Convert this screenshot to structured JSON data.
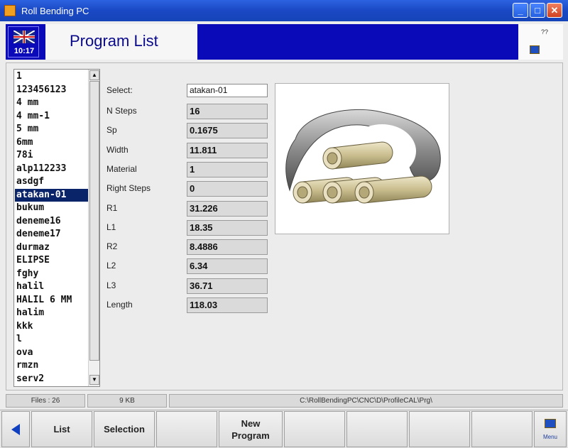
{
  "window": {
    "title": "Roll Bending PC"
  },
  "header": {
    "time": "10:17",
    "page_title": "Program List",
    "right_mark": "??"
  },
  "program_list": {
    "selected_index": 9,
    "items": [
      "1",
      "123456123",
      "4 mm",
      "4 mm-1",
      "5 mm",
      "6mm",
      "78i",
      "alp112233",
      "asdgf",
      "atakan-01",
      "bukum",
      "deneme16",
      "deneme17",
      "durmaz",
      "ELIPSE",
      "fghy",
      "halil",
      "HALIL 6 MM",
      "halim",
      "kkk",
      "l",
      "ova",
      "rmzn",
      "serv2"
    ]
  },
  "fields": {
    "select": {
      "label": "Select:",
      "value": "atakan-01"
    },
    "rows": [
      {
        "label": "N Steps",
        "value": "16"
      },
      {
        "label": "Sp",
        "value": "0.1675"
      },
      {
        "label": "Width",
        "value": "11.811"
      },
      {
        "label": "Material",
        "value": "1"
      },
      {
        "label": "Right Steps",
        "value": "0"
      },
      {
        "label": "R1",
        "value": "31.226"
      },
      {
        "label": "L1",
        "value": "18.35"
      },
      {
        "label": "R2",
        "value": "8.4886"
      },
      {
        "label": "L2",
        "value": "6.34"
      },
      {
        "label": "L3",
        "value": "36.71"
      },
      {
        "label": "Length",
        "value": "118.03"
      }
    ]
  },
  "status": {
    "files": "Files : 26",
    "size": "9 KB",
    "path": "C:\\RollBendingPC\\CNC\\D\\ProfileCAL\\Prg\\"
  },
  "fkeys": {
    "list": "List",
    "selection": "Selection",
    "new_program_line1": "New",
    "new_program_line2": "Program",
    "keyboard_label": "Menu"
  },
  "colors": {
    "header_blue": "#0a0ab8",
    "selection": "#0a246a",
    "title_text": "#0a0a8a"
  }
}
